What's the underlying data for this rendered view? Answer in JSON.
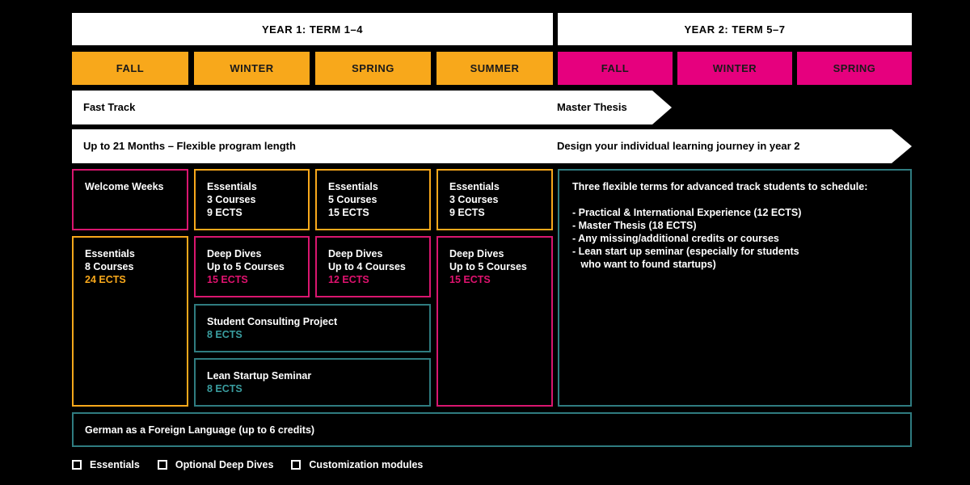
{
  "colors": {
    "essentials": "#f8a81b",
    "deep_dives": "#e6007e",
    "customization": "#2f7c80"
  },
  "header": {
    "year1": "YEAR 1: TERM 1–4",
    "year2": "YEAR 2: TERM 5–7"
  },
  "terms": [
    "FALL",
    "WINTER",
    "SPRING",
    "SUMMER",
    "FALL",
    "WINTER",
    "SPRING"
  ],
  "tracks": {
    "fast_track": "Fast Track",
    "master_thesis": "Master Thesis",
    "program_length": "Up to 21 Months – Flexible program length",
    "design_journey": "Design your individual learning journey in year 2"
  },
  "modules": {
    "welcome": "Welcome Weeks",
    "ess_fall": {
      "title": "Essentials",
      "courses": "8 Courses",
      "ects": "24 ECTS"
    },
    "ess_winter": {
      "title": "Essentials",
      "courses": "3 Courses",
      "ects": "9 ECTS"
    },
    "ess_spring": {
      "title": "Essentials",
      "courses": "5 Courses",
      "ects": "15 ECTS"
    },
    "ess_summer": {
      "title": "Essentials",
      "courses": "3 Courses",
      "ects": "9 ECTS"
    },
    "dd_winter": {
      "title": "Deep Dives",
      "courses": "Up to 5 Courses",
      "ects": "15 ECTS"
    },
    "dd_spring": {
      "title": "Deep Dives",
      "courses": "Up to 4 Courses",
      "ects": "12 ECTS"
    },
    "dd_summer": {
      "title": "Deep Dives",
      "courses": "Up to 5 Courses",
      "ects": "15 ECTS"
    },
    "consulting": {
      "title": "Student Consulting Project",
      "ects": "8 ECTS"
    },
    "lean": {
      "title": "Lean Startup Seminar",
      "ects": "8 ECTS"
    },
    "year2": {
      "intro": "Three flexible terms for advanced track students to schedule:",
      "items": [
        "- Practical & International Experience (12 ECTS)",
        "- Master Thesis (18 ECTS)",
        "- Any missing/additional credits or courses",
        "- Lean start up seminar (especially for students",
        "   who want to found startups)"
      ]
    },
    "german": "German as a Foreign Language (up to 6 credits)"
  },
  "legend": {
    "essentials": "Essentials",
    "deep_dives": "Optional Deep Dives",
    "customization": "Customization modules"
  }
}
